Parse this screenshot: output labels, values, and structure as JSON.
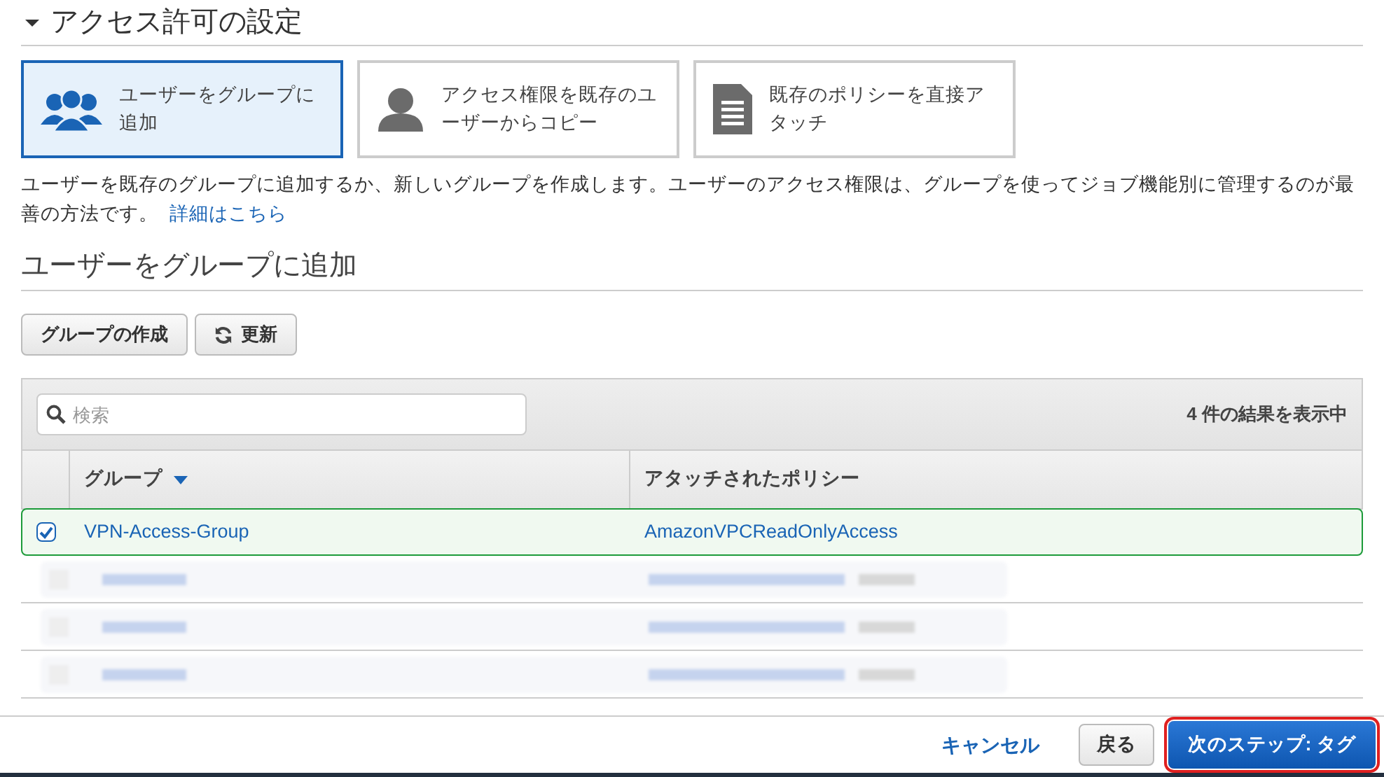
{
  "section": {
    "title": "アクセス許可の設定",
    "expanded": true
  },
  "options": [
    {
      "kind": "group",
      "label": "ユーザーをグループに追加",
      "selected": true
    },
    {
      "kind": "user",
      "label": "アクセス権限を既存のユーザーからコピー",
      "selected": false
    },
    {
      "kind": "document",
      "label": "既存のポリシーを直接アタッチ",
      "selected": false
    }
  ],
  "description": {
    "text": "ユーザーを既存のグループに追加するか、新しいグループを作成します。ユーザーのアクセス権限は、グループを使ってジョブ機能別に管理するのが最善の方法です。",
    "link": "詳細はこちら"
  },
  "group_section": {
    "title": "ユーザーをグループに追加"
  },
  "toolbar": {
    "buttons": [
      {
        "label": "グループの作成",
        "kind": "create"
      },
      {
        "label": "更新",
        "kind": "refresh"
      }
    ]
  },
  "table": {
    "search": {
      "placeholder": "検索"
    },
    "result_count": "4 件の結果を表示中",
    "columns": [
      {
        "label": "グループ",
        "sorted": true
      },
      {
        "label": "アタッチされたポリシー",
        "sorted": false
      }
    ],
    "rows": [
      {
        "kind": "visible",
        "group": "VPN-Access-Group",
        "policy": "AmazonVPCReadOnlyAccess",
        "selected": true
      },
      {
        "kind": "redacted"
      },
      {
        "kind": "redacted"
      },
      {
        "kind": "redacted"
      }
    ]
  },
  "footer": {
    "cancel": "キャンセル",
    "back": "戻る",
    "next": "次のステップ: タグ"
  }
}
